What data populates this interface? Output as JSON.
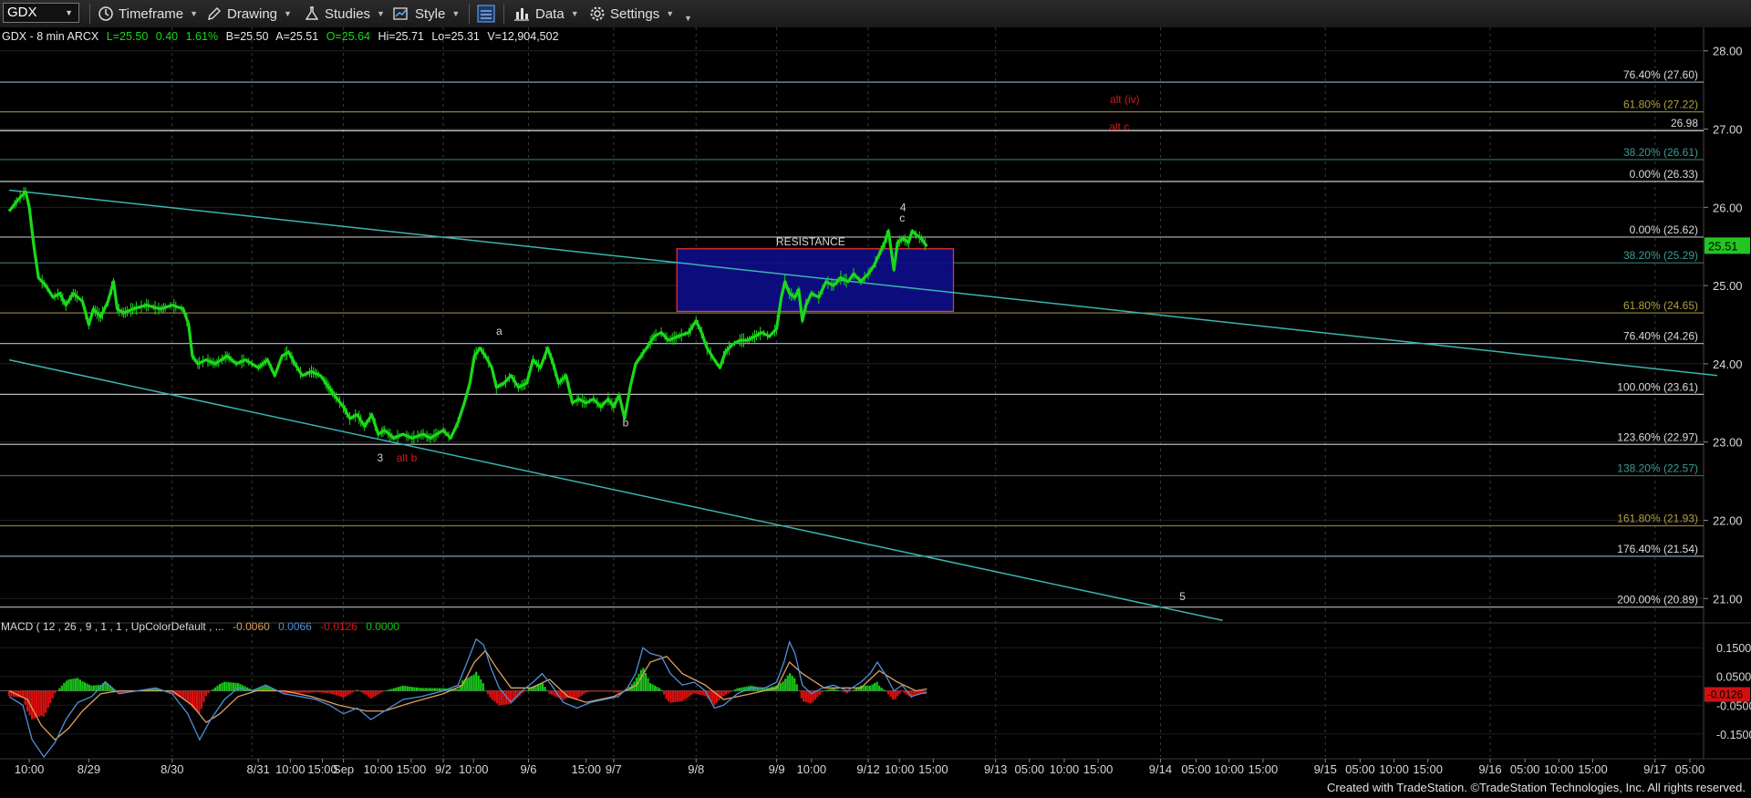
{
  "toolbar": {
    "symbol": "GDX",
    "timeframe_label": "Timeframe",
    "drawing_label": "Drawing",
    "studies_label": "Studies",
    "style_label": "Style",
    "data_label": "Data",
    "settings_label": "Settings"
  },
  "header": {
    "title": "GDX - 8 min  ARCX",
    "last": "L=25.50",
    "change": "0.40",
    "pct": "1.61%",
    "bid": "B=25.50",
    "ask": "A=25.51",
    "open": "O=25.64",
    "high": "Hi=25.71",
    "low": "Lo=25.31",
    "volume": "V=12,904,502"
  },
  "colors": {
    "background": "#000000",
    "price": "#19d919",
    "macd_line": "#4f8fd8",
    "signal_line": "#e0a060",
    "hist_up": "#19c519",
    "hist_down": "#e01010",
    "trendline": "#3ab4b0",
    "resistance_fill": "#0d0d8a",
    "resistance_border": "#ff3030",
    "label_red": "#d01818",
    "last_price_tag": "#22c522"
  },
  "chart_data": {
    "type": "line",
    "symbol": "GDX",
    "y_range": [
      20.7,
      28.3
    ],
    "price_ticks": [
      21.0,
      22.0,
      23.0,
      24.0,
      25.0,
      26.0,
      27.0,
      28.0
    ],
    "price_tick_labels": [
      "21.00",
      "22.00",
      "23.00",
      "24.00",
      "25.00",
      "26.00",
      "27.00",
      "28.00"
    ],
    "last_price": 25.51,
    "last_price_label": "25.51",
    "x_range": [
      -10,
      1850
    ],
    "x_ticks": [
      {
        "t": 22,
        "label": "10:00"
      },
      {
        "t": 87,
        "label": "8/29"
      },
      {
        "t": 178,
        "label": "8/30"
      },
      {
        "t": 272,
        "label": "8/31"
      },
      {
        "t": 307,
        "label": "10:00"
      },
      {
        "t": 342,
        "label": "15:00"
      },
      {
        "t": 365,
        "label": "Sep"
      },
      {
        "t": 403,
        "label": "10:00"
      },
      {
        "t": 439,
        "label": "15:00"
      },
      {
        "t": 474,
        "label": "9/2"
      },
      {
        "t": 507,
        "label": "10:00"
      },
      {
        "t": 567,
        "label": "9/6"
      },
      {
        "t": 630,
        "label": "15:00"
      },
      {
        "t": 660,
        "label": "9/7"
      },
      {
        "t": 750,
        "label": "9/8"
      },
      {
        "t": 838,
        "label": "9/9"
      },
      {
        "t": 876,
        "label": "10:00"
      },
      {
        "t": 938,
        "label": "9/12"
      },
      {
        "t": 972,
        "label": "10:00"
      },
      {
        "t": 1009,
        "label": "15:00"
      },
      {
        "t": 1077,
        "label": "9/13"
      },
      {
        "t": 1114,
        "label": "05:00"
      },
      {
        "t": 1152,
        "label": "10:00"
      },
      {
        "t": 1189,
        "label": "15:00"
      },
      {
        "t": 1257,
        "label": "9/14"
      },
      {
        "t": 1296,
        "label": "05:00"
      },
      {
        "t": 1332,
        "label": "10:00"
      },
      {
        "t": 1369,
        "label": "15:00"
      },
      {
        "t": 1437,
        "label": "9/15"
      },
      {
        "t": 1475,
        "label": "05:00"
      },
      {
        "t": 1512,
        "label": "10:00"
      },
      {
        "t": 1549,
        "label": "15:00"
      },
      {
        "t": 1617,
        "label": "9/16"
      },
      {
        "t": 1655,
        "label": "05:00"
      },
      {
        "t": 1692,
        "label": "10:00"
      },
      {
        "t": 1729,
        "label": "15:00"
      },
      {
        "t": 1797,
        "label": "9/17"
      },
      {
        "t": 1835,
        "label": "05:00"
      }
    ],
    "session_lines": [
      178,
      265,
      365,
      474,
      567,
      660,
      750,
      838,
      938,
      1077,
      1257,
      1437,
      1617,
      1797
    ],
    "price_path": [
      [
        0,
        25.95
      ],
      [
        10,
        26.1
      ],
      [
        18,
        26.2
      ],
      [
        22,
        26.0
      ],
      [
        27,
        25.5
      ],
      [
        32,
        25.1
      ],
      [
        40,
        25.0
      ],
      [
        48,
        24.85
      ],
      [
        55,
        24.9
      ],
      [
        62,
        24.75
      ],
      [
        70,
        24.9
      ],
      [
        80,
        24.8
      ],
      [
        87,
        24.5
      ],
      [
        92,
        24.7
      ],
      [
        100,
        24.6
      ],
      [
        108,
        24.8
      ],
      [
        114,
        25.05
      ],
      [
        118,
        24.7
      ],
      [
        125,
        24.65
      ],
      [
        135,
        24.7
      ],
      [
        150,
        24.75
      ],
      [
        165,
        24.7
      ],
      [
        178,
        24.75
      ],
      [
        190,
        24.7
      ],
      [
        196,
        24.5
      ],
      [
        200,
        24.1
      ],
      [
        206,
        24.0
      ],
      [
        215,
        24.05
      ],
      [
        225,
        24.0
      ],
      [
        238,
        24.1
      ],
      [
        248,
        24.0
      ],
      [
        258,
        24.05
      ],
      [
        265,
        24.0
      ],
      [
        272,
        23.95
      ],
      [
        282,
        24.05
      ],
      [
        290,
        23.85
      ],
      [
        298,
        24.1
      ],
      [
        305,
        24.15
      ],
      [
        312,
        24.0
      ],
      [
        320,
        23.85
      ],
      [
        330,
        23.9
      ],
      [
        340,
        23.85
      ],
      [
        355,
        23.6
      ],
      [
        365,
        23.45
      ],
      [
        372,
        23.3
      ],
      [
        380,
        23.35
      ],
      [
        388,
        23.2
      ],
      [
        396,
        23.35
      ],
      [
        403,
        23.1
      ],
      [
        410,
        23.15
      ],
      [
        420,
        23.05
      ],
      [
        430,
        23.1
      ],
      [
        440,
        23.05
      ],
      [
        452,
        23.1
      ],
      [
        460,
        23.05
      ],
      [
        474,
        23.15
      ],
      [
        482,
        23.05
      ],
      [
        490,
        23.25
      ],
      [
        497,
        23.5
      ],
      [
        503,
        23.75
      ],
      [
        508,
        24.1
      ],
      [
        514,
        24.2
      ],
      [
        520,
        24.1
      ],
      [
        527,
        23.95
      ],
      [
        532,
        23.7
      ],
      [
        540,
        23.75
      ],
      [
        548,
        23.85
      ],
      [
        556,
        23.7
      ],
      [
        565,
        23.75
      ],
      [
        572,
        24.05
      ],
      [
        580,
        23.95
      ],
      [
        588,
        24.2
      ],
      [
        594,
        24.0
      ],
      [
        600,
        23.75
      ],
      [
        608,
        23.85
      ],
      [
        615,
        23.5
      ],
      [
        622,
        23.55
      ],
      [
        630,
        23.5
      ],
      [
        638,
        23.55
      ],
      [
        646,
        23.45
      ],
      [
        654,
        23.55
      ],
      [
        660,
        23.45
      ],
      [
        666,
        23.6
      ],
      [
        672,
        23.3
      ],
      [
        678,
        23.7
      ],
      [
        684,
        24.0
      ],
      [
        690,
        24.1
      ],
      [
        696,
        24.2
      ],
      [
        704,
        24.35
      ],
      [
        712,
        24.4
      ],
      [
        720,
        24.3
      ],
      [
        730,
        24.35
      ],
      [
        742,
        24.4
      ],
      [
        750,
        24.55
      ],
      [
        756,
        24.4
      ],
      [
        762,
        24.2
      ],
      [
        770,
        24.05
      ],
      [
        776,
        23.95
      ],
      [
        782,
        24.15
      ],
      [
        790,
        24.25
      ],
      [
        798,
        24.3
      ],
      [
        806,
        24.3
      ],
      [
        814,
        24.35
      ],
      [
        822,
        24.4
      ],
      [
        830,
        24.35
      ],
      [
        838,
        24.45
      ],
      [
        843,
        24.85
      ],
      [
        847,
        25.05
      ],
      [
        852,
        24.9
      ],
      [
        858,
        24.85
      ],
      [
        862,
        24.95
      ],
      [
        866,
        24.55
      ],
      [
        870,
        24.75
      ],
      [
        876,
        24.9
      ],
      [
        884,
        24.85
      ],
      [
        892,
        25.05
      ],
      [
        900,
        25.0
      ],
      [
        908,
        25.1
      ],
      [
        916,
        25.05
      ],
      [
        922,
        25.15
      ],
      [
        930,
        25.05
      ],
      [
        938,
        25.15
      ],
      [
        944,
        25.25
      ],
      [
        950,
        25.4
      ],
      [
        956,
        25.55
      ],
      [
        960,
        25.7
      ],
      [
        966,
        25.2
      ],
      [
        970,
        25.55
      ],
      [
        976,
        25.6
      ],
      [
        982,
        25.55
      ],
      [
        986,
        25.7
      ],
      [
        990,
        25.65
      ],
      [
        996,
        25.6
      ],
      [
        1002,
        25.5
      ]
    ],
    "fib_levels": [
      {
        "price": 27.6,
        "label": "76.40% (27.60)",
        "color": "#8fb0c8"
      },
      {
        "price": 27.22,
        "label": "61.80% (27.22)",
        "color": "#8a7e38"
      },
      {
        "price": 26.98,
        "label": "26.98",
        "color": "#d8d8d8"
      },
      {
        "price": 26.61,
        "label": "38.20% (26.61)",
        "color": "#2e6d6a"
      },
      {
        "price": 26.33,
        "label": "0.00% (26.33)",
        "color": "#c8c8c8"
      },
      {
        "price": 25.62,
        "label": "0.00% (25.62)",
        "color": "#b8b8b8"
      },
      {
        "price": 25.29,
        "label": "38.20% (25.29)",
        "color": "#2e6d6a"
      },
      {
        "price": 24.65,
        "label": "61.80% (24.65)",
        "color": "#8a7e38"
      },
      {
        "price": 24.26,
        "label": "76.40% (24.26)",
        "color": "#8fb0c8"
      },
      {
        "price": 23.61,
        "label": "100.00% (23.61)",
        "color": "#b8b8b8"
      },
      {
        "price": 22.97,
        "label": "123.60% (22.97)",
        "color": "#b8b8b8"
      },
      {
        "price": 22.57,
        "label": "138.20% (22.57)",
        "color": "#2e6d6a"
      },
      {
        "price": 21.93,
        "label": "161.80% (21.93)",
        "color": "#8a7e38"
      },
      {
        "price": 21.54,
        "label": "176.40% (21.54)",
        "color": "#8fb0c8"
      },
      {
        "price": 20.89,
        "label": "200.00% (20.89)",
        "color": "#b8b8b8"
      }
    ],
    "trendlines": [
      {
        "from": [
          0,
          26.22
        ],
        "to": [
          1865,
          23.85
        ]
      },
      {
        "from": [
          0,
          24.05
        ],
        "to": [
          1325,
          20.72
        ]
      }
    ],
    "resistance_box": {
      "t0": 729,
      "t1": 1031,
      "p_top": 25.47,
      "p_bottom": 24.67,
      "label": "RESISTANCE"
    },
    "wave_labels": [
      {
        "t": 405,
        "p": 22.75,
        "text": "3",
        "color": "#d0d0d0"
      },
      {
        "t": 434,
        "p": 22.75,
        "text": "alt b",
        "color": "#d01818"
      },
      {
        "t": 535,
        "p": 24.37,
        "text": "a",
        "color": "#d0d0d0"
      },
      {
        "t": 673,
        "p": 23.2,
        "text": "b",
        "color": "#d0d0d0"
      },
      {
        "t": 976,
        "p": 25.95,
        "text": "4",
        "color": "#d0d0d0"
      },
      {
        "t": 975,
        "p": 25.82,
        "text": "c",
        "color": "#d0d0d0"
      },
      {
        "t": 1218,
        "p": 27.33,
        "text": "alt (iv)",
        "color": "#d01818"
      },
      {
        "t": 1212,
        "p": 26.98,
        "text": "alt c",
        "color": "#d01818"
      },
      {
        "t": 1281,
        "p": 20.98,
        "text": "5",
        "color": "#d0d0d0"
      }
    ],
    "macd": {
      "title": "MACD ( 12 , 26 , 9 , 1 , 1 , UpColorDefault , ...",
      "value1": "-0.0060",
      "value2": "0.0066",
      "value3": "-0.0126",
      "value4": "0.0000",
      "y_range": [
        -0.23,
        0.23
      ],
      "ticks": [
        0.15,
        0.05,
        -0.05,
        -0.15
      ],
      "tick_labels": [
        "0.1500",
        "0.0500",
        "-0.0500",
        "-0.1500"
      ],
      "last_label": "-0.0126",
      "macd_path": [
        [
          0,
          -0.02
        ],
        [
          15,
          -0.05
        ],
        [
          25,
          -0.17
        ],
        [
          38,
          -0.23
        ],
        [
          50,
          -0.18
        ],
        [
          62,
          -0.1
        ],
        [
          75,
          -0.04
        ],
        [
          90,
          -0.02
        ],
        [
          105,
          0.03
        ],
        [
          120,
          -0.01
        ],
        [
          140,
          0.0
        ],
        [
          160,
          0.01
        ],
        [
          178,
          -0.01
        ],
        [
          195,
          -0.08
        ],
        [
          208,
          -0.17
        ],
        [
          220,
          -0.1
        ],
        [
          235,
          -0.03
        ],
        [
          250,
          0.01
        ],
        [
          265,
          0.0
        ],
        [
          280,
          0.02
        ],
        [
          300,
          -0.01
        ],
        [
          318,
          -0.02
        ],
        [
          335,
          -0.03
        ],
        [
          350,
          -0.05
        ],
        [
          365,
          -0.08
        ],
        [
          380,
          -0.06
        ],
        [
          395,
          -0.1
        ],
        [
          410,
          -0.07
        ],
        [
          430,
          -0.03
        ],
        [
          450,
          -0.02
        ],
        [
          474,
          0.0
        ],
        [
          490,
          0.02
        ],
        [
          500,
          0.1
        ],
        [
          510,
          0.18
        ],
        [
          518,
          0.16
        ],
        [
          526,
          0.08
        ],
        [
          535,
          0.01
        ],
        [
          548,
          -0.04
        ],
        [
          560,
          0.0
        ],
        [
          572,
          0.03
        ],
        [
          582,
          0.06
        ],
        [
          592,
          0.02
        ],
        [
          605,
          -0.04
        ],
        [
          620,
          -0.06
        ],
        [
          635,
          -0.04
        ],
        [
          650,
          -0.03
        ],
        [
          665,
          -0.02
        ],
        [
          675,
          0.01
        ],
        [
          684,
          0.06
        ],
        [
          692,
          0.15
        ],
        [
          700,
          0.13
        ],
        [
          712,
          0.12
        ],
        [
          722,
          0.06
        ],
        [
          735,
          0.02
        ],
        [
          748,
          0.03
        ],
        [
          760,
          0.0
        ],
        [
          770,
          -0.06
        ],
        [
          780,
          -0.05
        ],
        [
          795,
          -0.01
        ],
        [
          810,
          0.01
        ],
        [
          825,
          0.01
        ],
        [
          838,
          0.03
        ],
        [
          846,
          0.1
        ],
        [
          852,
          0.17
        ],
        [
          858,
          0.13
        ],
        [
          866,
          0.02
        ],
        [
          876,
          -0.01
        ],
        [
          888,
          0.01
        ],
        [
          900,
          0.02
        ],
        [
          915,
          0.0
        ],
        [
          930,
          0.03
        ],
        [
          940,
          0.06
        ],
        [
          948,
          0.1
        ],
        [
          956,
          0.06
        ],
        [
          966,
          0.0
        ],
        [
          975,
          0.02
        ],
        [
          985,
          -0.02
        ],
        [
          995,
          -0.01
        ],
        [
          1002,
          -0.006
        ]
      ],
      "signal_path": [
        [
          0,
          0.0
        ],
        [
          20,
          -0.03
        ],
        [
          35,
          -0.12
        ],
        [
          50,
          -0.17
        ],
        [
          65,
          -0.13
        ],
        [
          80,
          -0.07
        ],
        [
          100,
          -0.01
        ],
        [
          120,
          0.0
        ],
        [
          150,
          0.0
        ],
        [
          178,
          0.0
        ],
        [
          200,
          -0.05
        ],
        [
          215,
          -0.11
        ],
        [
          230,
          -0.08
        ],
        [
          250,
          -0.02
        ],
        [
          270,
          0.0
        ],
        [
          300,
          0.0
        ],
        [
          330,
          -0.02
        ],
        [
          360,
          -0.05
        ],
        [
          390,
          -0.07
        ],
        [
          410,
          -0.07
        ],
        [
          440,
          -0.04
        ],
        [
          474,
          -0.01
        ],
        [
          495,
          0.02
        ],
        [
          508,
          0.1
        ],
        [
          520,
          0.14
        ],
        [
          532,
          0.08
        ],
        [
          548,
          0.01
        ],
        [
          570,
          0.01
        ],
        [
          590,
          0.04
        ],
        [
          610,
          -0.02
        ],
        [
          630,
          -0.04
        ],
        [
          660,
          -0.02
        ],
        [
          685,
          0.02
        ],
        [
          700,
          0.1
        ],
        [
          718,
          0.12
        ],
        [
          735,
          0.06
        ],
        [
          760,
          0.02
        ],
        [
          780,
          -0.03
        ],
        [
          810,
          -0.01
        ],
        [
          838,
          0.01
        ],
        [
          852,
          0.1
        ],
        [
          866,
          0.06
        ],
        [
          890,
          0.01
        ],
        [
          930,
          0.01
        ],
        [
          950,
          0.07
        ],
        [
          970,
          0.03
        ],
        [
          990,
          0.0
        ],
        [
          1002,
          0.0066
        ]
      ]
    }
  },
  "footer": {
    "credit": "Created with TradeStation. ©TradeStation Technologies, Inc. All rights reserved."
  }
}
